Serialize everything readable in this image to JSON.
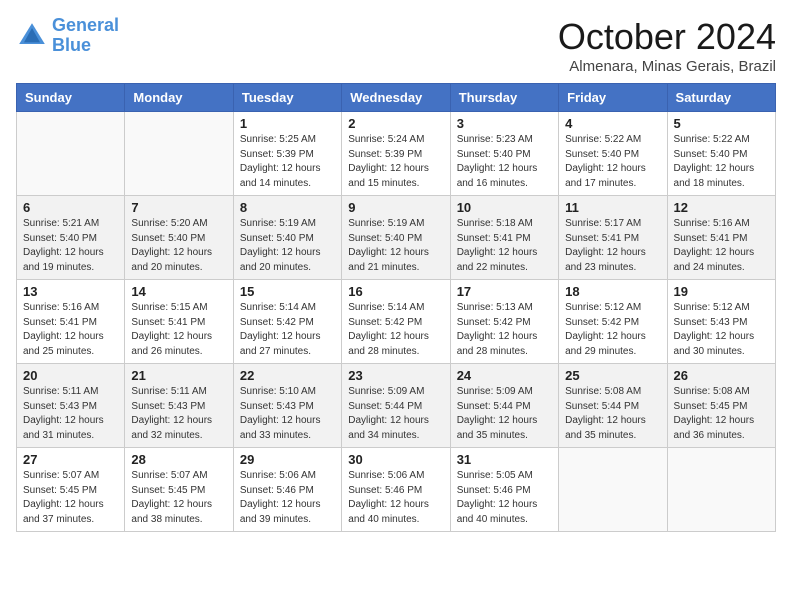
{
  "header": {
    "logo_line1": "General",
    "logo_line2": "Blue",
    "month": "October 2024",
    "location": "Almenara, Minas Gerais, Brazil"
  },
  "weekdays": [
    "Sunday",
    "Monday",
    "Tuesday",
    "Wednesday",
    "Thursday",
    "Friday",
    "Saturday"
  ],
  "weeks": [
    [
      {
        "day": "",
        "sunrise": "",
        "sunset": "",
        "daylight": ""
      },
      {
        "day": "",
        "sunrise": "",
        "sunset": "",
        "daylight": ""
      },
      {
        "day": "1",
        "sunrise": "Sunrise: 5:25 AM",
        "sunset": "Sunset: 5:39 PM",
        "daylight": "Daylight: 12 hours and 14 minutes."
      },
      {
        "day": "2",
        "sunrise": "Sunrise: 5:24 AM",
        "sunset": "Sunset: 5:39 PM",
        "daylight": "Daylight: 12 hours and 15 minutes."
      },
      {
        "day": "3",
        "sunrise": "Sunrise: 5:23 AM",
        "sunset": "Sunset: 5:40 PM",
        "daylight": "Daylight: 12 hours and 16 minutes."
      },
      {
        "day": "4",
        "sunrise": "Sunrise: 5:22 AM",
        "sunset": "Sunset: 5:40 PM",
        "daylight": "Daylight: 12 hours and 17 minutes."
      },
      {
        "day": "5",
        "sunrise": "Sunrise: 5:22 AM",
        "sunset": "Sunset: 5:40 PM",
        "daylight": "Daylight: 12 hours and 18 minutes."
      }
    ],
    [
      {
        "day": "6",
        "sunrise": "Sunrise: 5:21 AM",
        "sunset": "Sunset: 5:40 PM",
        "daylight": "Daylight: 12 hours and 19 minutes."
      },
      {
        "day": "7",
        "sunrise": "Sunrise: 5:20 AM",
        "sunset": "Sunset: 5:40 PM",
        "daylight": "Daylight: 12 hours and 20 minutes."
      },
      {
        "day": "8",
        "sunrise": "Sunrise: 5:19 AM",
        "sunset": "Sunset: 5:40 PM",
        "daylight": "Daylight: 12 hours and 20 minutes."
      },
      {
        "day": "9",
        "sunrise": "Sunrise: 5:19 AM",
        "sunset": "Sunset: 5:40 PM",
        "daylight": "Daylight: 12 hours and 21 minutes."
      },
      {
        "day": "10",
        "sunrise": "Sunrise: 5:18 AM",
        "sunset": "Sunset: 5:41 PM",
        "daylight": "Daylight: 12 hours and 22 minutes."
      },
      {
        "day": "11",
        "sunrise": "Sunrise: 5:17 AM",
        "sunset": "Sunset: 5:41 PM",
        "daylight": "Daylight: 12 hours and 23 minutes."
      },
      {
        "day": "12",
        "sunrise": "Sunrise: 5:16 AM",
        "sunset": "Sunset: 5:41 PM",
        "daylight": "Daylight: 12 hours and 24 minutes."
      }
    ],
    [
      {
        "day": "13",
        "sunrise": "Sunrise: 5:16 AM",
        "sunset": "Sunset: 5:41 PM",
        "daylight": "Daylight: 12 hours and 25 minutes."
      },
      {
        "day": "14",
        "sunrise": "Sunrise: 5:15 AM",
        "sunset": "Sunset: 5:41 PM",
        "daylight": "Daylight: 12 hours and 26 minutes."
      },
      {
        "day": "15",
        "sunrise": "Sunrise: 5:14 AM",
        "sunset": "Sunset: 5:42 PM",
        "daylight": "Daylight: 12 hours and 27 minutes."
      },
      {
        "day": "16",
        "sunrise": "Sunrise: 5:14 AM",
        "sunset": "Sunset: 5:42 PM",
        "daylight": "Daylight: 12 hours and 28 minutes."
      },
      {
        "day": "17",
        "sunrise": "Sunrise: 5:13 AM",
        "sunset": "Sunset: 5:42 PM",
        "daylight": "Daylight: 12 hours and 28 minutes."
      },
      {
        "day": "18",
        "sunrise": "Sunrise: 5:12 AM",
        "sunset": "Sunset: 5:42 PM",
        "daylight": "Daylight: 12 hours and 29 minutes."
      },
      {
        "day": "19",
        "sunrise": "Sunrise: 5:12 AM",
        "sunset": "Sunset: 5:43 PM",
        "daylight": "Daylight: 12 hours and 30 minutes."
      }
    ],
    [
      {
        "day": "20",
        "sunrise": "Sunrise: 5:11 AM",
        "sunset": "Sunset: 5:43 PM",
        "daylight": "Daylight: 12 hours and 31 minutes."
      },
      {
        "day": "21",
        "sunrise": "Sunrise: 5:11 AM",
        "sunset": "Sunset: 5:43 PM",
        "daylight": "Daylight: 12 hours and 32 minutes."
      },
      {
        "day": "22",
        "sunrise": "Sunrise: 5:10 AM",
        "sunset": "Sunset: 5:43 PM",
        "daylight": "Daylight: 12 hours and 33 minutes."
      },
      {
        "day": "23",
        "sunrise": "Sunrise: 5:09 AM",
        "sunset": "Sunset: 5:44 PM",
        "daylight": "Daylight: 12 hours and 34 minutes."
      },
      {
        "day": "24",
        "sunrise": "Sunrise: 5:09 AM",
        "sunset": "Sunset: 5:44 PM",
        "daylight": "Daylight: 12 hours and 35 minutes."
      },
      {
        "day": "25",
        "sunrise": "Sunrise: 5:08 AM",
        "sunset": "Sunset: 5:44 PM",
        "daylight": "Daylight: 12 hours and 35 minutes."
      },
      {
        "day": "26",
        "sunrise": "Sunrise: 5:08 AM",
        "sunset": "Sunset: 5:45 PM",
        "daylight": "Daylight: 12 hours and 36 minutes."
      }
    ],
    [
      {
        "day": "27",
        "sunrise": "Sunrise: 5:07 AM",
        "sunset": "Sunset: 5:45 PM",
        "daylight": "Daylight: 12 hours and 37 minutes."
      },
      {
        "day": "28",
        "sunrise": "Sunrise: 5:07 AM",
        "sunset": "Sunset: 5:45 PM",
        "daylight": "Daylight: 12 hours and 38 minutes."
      },
      {
        "day": "29",
        "sunrise": "Sunrise: 5:06 AM",
        "sunset": "Sunset: 5:46 PM",
        "daylight": "Daylight: 12 hours and 39 minutes."
      },
      {
        "day": "30",
        "sunrise": "Sunrise: 5:06 AM",
        "sunset": "Sunset: 5:46 PM",
        "daylight": "Daylight: 12 hours and 40 minutes."
      },
      {
        "day": "31",
        "sunrise": "Sunrise: 5:05 AM",
        "sunset": "Sunset: 5:46 PM",
        "daylight": "Daylight: 12 hours and 40 minutes."
      },
      {
        "day": "",
        "sunrise": "",
        "sunset": "",
        "daylight": ""
      },
      {
        "day": "",
        "sunrise": "",
        "sunset": "",
        "daylight": ""
      }
    ]
  ]
}
